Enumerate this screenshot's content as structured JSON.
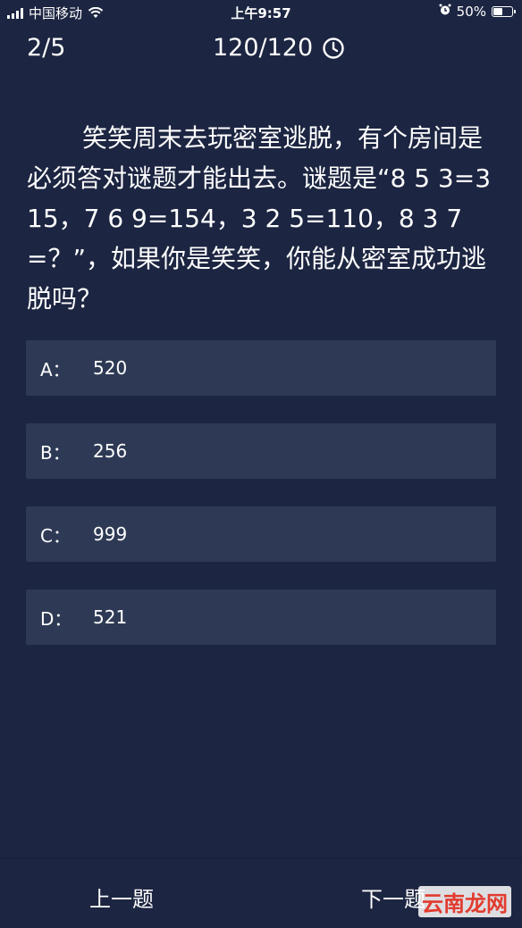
{
  "status_bar": {
    "carrier": "中国移动",
    "time": "上午9:57",
    "battery": "50%",
    "battery_level": 0.5
  },
  "header": {
    "progress": "2/5",
    "timer": "120/120"
  },
  "question": {
    "text": "笑笑周末去玩密室逃脱，有个房间是必须答对谜题才能出去。谜题是“8 5 3=315，7 6 9=154，3 2 5=110，8 3 7=？”，如果你是笑笑，你能从密室成功逃脱吗？"
  },
  "options": [
    {
      "letter": "A：",
      "value": "520"
    },
    {
      "letter": "B：",
      "value": "256"
    },
    {
      "letter": "C：",
      "value": "999"
    },
    {
      "letter": "D：",
      "value": "521"
    }
  ],
  "footer": {
    "prev_label": "上一题",
    "next_label": "下一题",
    "watermark": "云南龙网"
  },
  "colors": {
    "background": "#1c2541",
    "option_bg": "#2e3a55",
    "text": "#ffffff",
    "watermark": "#e23b2e"
  }
}
